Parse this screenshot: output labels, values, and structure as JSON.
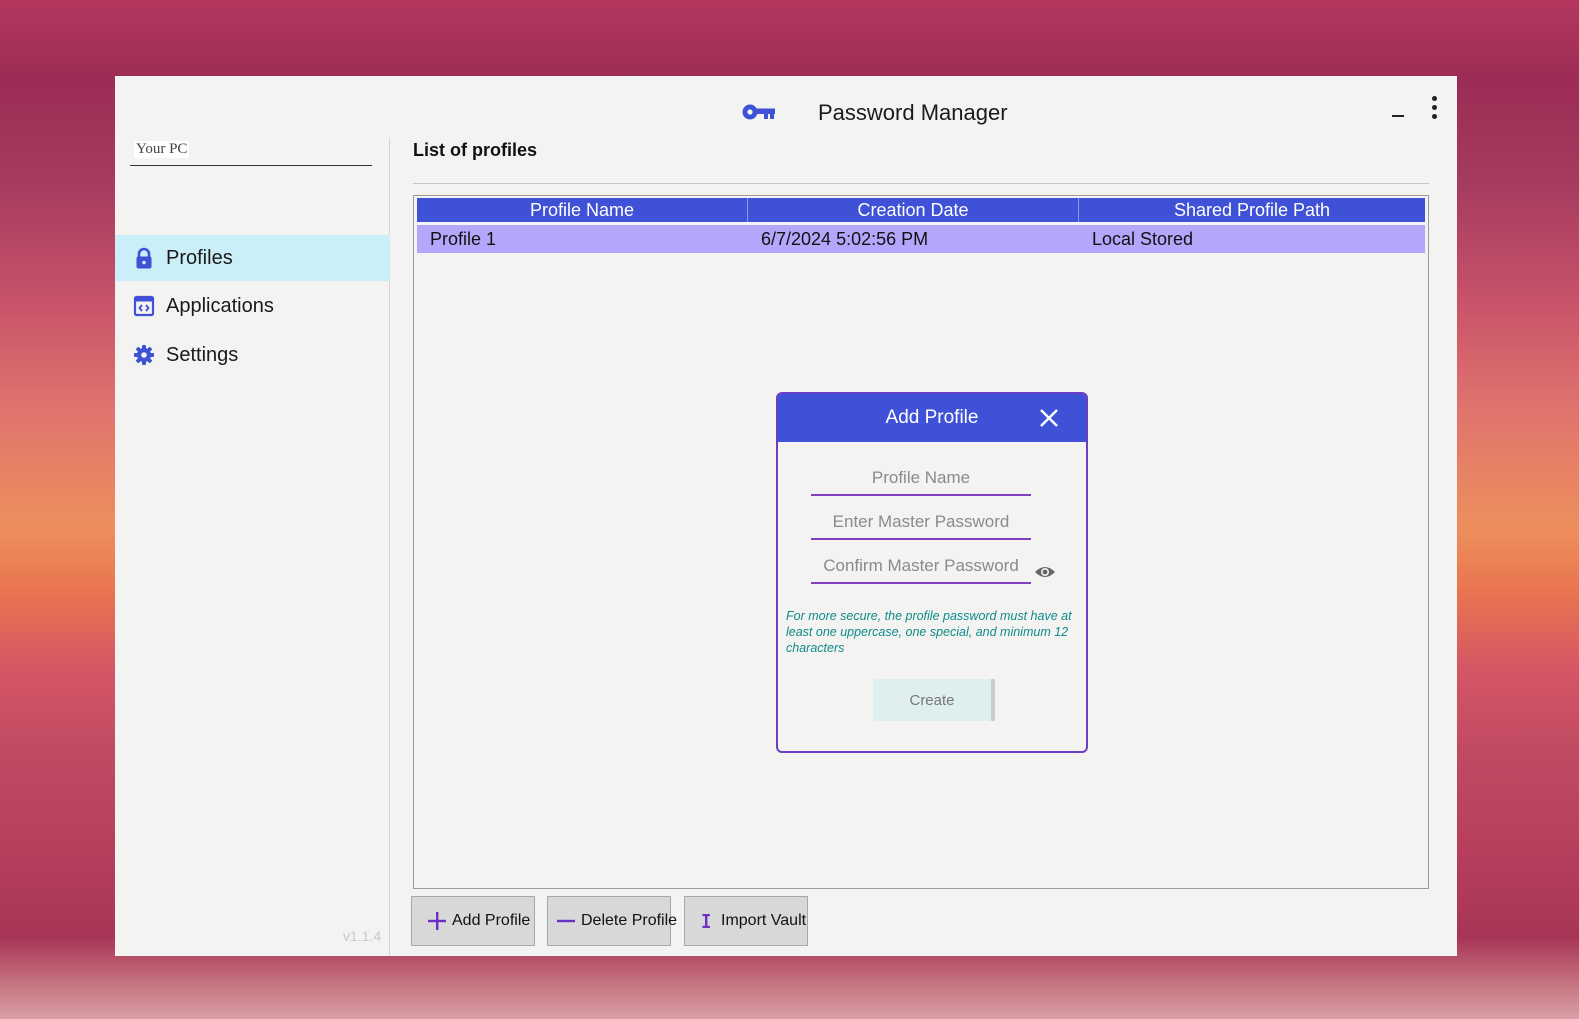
{
  "app": {
    "title": "Password Manager",
    "icon": "key-icon",
    "version": "v1.1.4"
  },
  "sidebar": {
    "pc_select": "Your PC",
    "items": [
      {
        "label": "Profiles",
        "icon": "lock-icon",
        "active": true
      },
      {
        "label": "Applications",
        "icon": "application-window-icon",
        "active": false
      },
      {
        "label": "Settings",
        "icon": "gear-icon",
        "active": false
      }
    ]
  },
  "main": {
    "title": "List of profiles",
    "table": {
      "columns": [
        "Profile Name",
        "Creation Date",
        "Shared Profile Path"
      ],
      "rows": [
        [
          "Profile 1",
          "6/7/2024 5:02:56 PM",
          "Local Stored"
        ]
      ]
    },
    "buttons": {
      "add": "Add Profile",
      "delete": "Delete Profile",
      "import": "Import Vault"
    }
  },
  "dialog": {
    "title": "Add Profile",
    "profile_name_placeholder": "Profile Name",
    "master_password_placeholder": "Enter Master Password",
    "confirm_password_placeholder": "Confirm Master Password",
    "hint": "For more secure, the profile password must have at least one uppercase, one special, and minimum 12 characters",
    "create_label": "Create"
  },
  "colors": {
    "accent": "#3f51d6",
    "selected_row": "#b3a7fb",
    "active_nav": "#cbeff9",
    "dialog_border": "#6a3fc6",
    "hint_text": "#0f8a8a"
  }
}
